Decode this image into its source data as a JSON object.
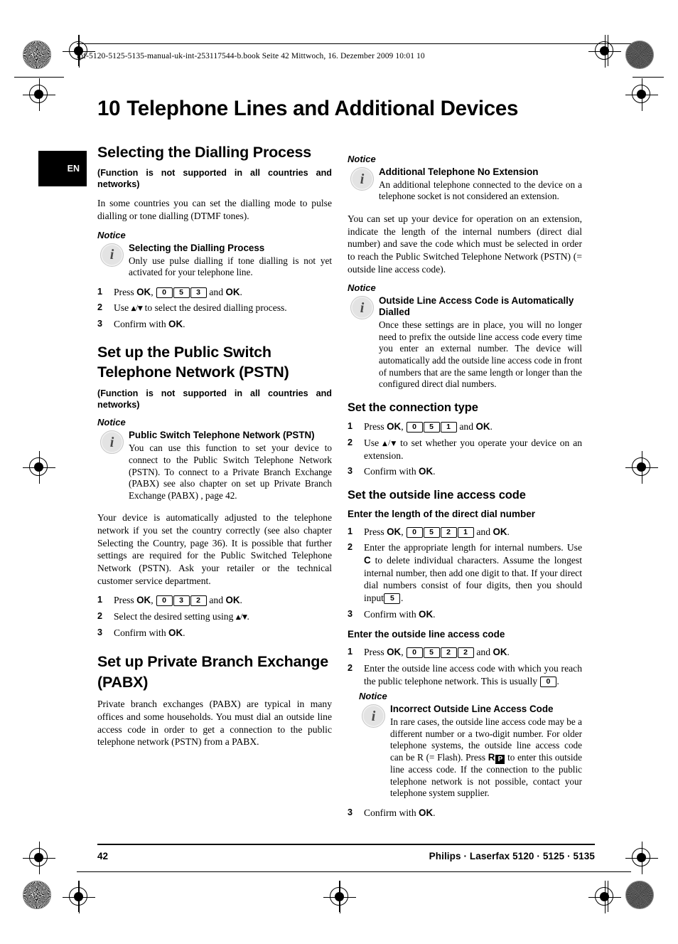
{
  "slug": "lpf-5120-5125-5135-manual-uk-int-253117544-b.book  Seite 42  Mittwoch, 16. Dezember 2009  10:01 10",
  "chapter": {
    "number": "10",
    "title": "Telephone Lines and Additional Devices"
  },
  "language_tab": "EN",
  "left_column": {
    "section1": {
      "heading": "Selecting the Dialling Process",
      "bold_note": "(Function is not supported in all countries and networks)",
      "intro": "In some countries you can set the dialling mode to pulse dialling or tone dialling (DTMF tones).",
      "notice_label": "Notice",
      "notice_title": "Selecting the Dialling Process",
      "notice_text": "Only use pulse dialling if tone dialling is not yet activated for your telephone line.",
      "steps": [
        {
          "n": "1",
          "text_pre": "Press ",
          "ok1": "OK",
          "comma": ", ",
          "keys": [
            "0",
            "5",
            "3"
          ],
          "text_mid": " and ",
          "ok2": "OK",
          "text_post": "."
        },
        {
          "n": "2",
          "text_pre": "Use ",
          "arrows": true,
          "text_post": " to select the desired dialling process."
        },
        {
          "n": "3",
          "text_pre": "Confirm with ",
          "ok1": "OK",
          "text_post": "."
        }
      ]
    },
    "section2": {
      "heading": "Set up the Public Switch Telephone Network (PSTN)",
      "bold_note": "(Function is not supported in all countries and networks)",
      "notice_label": "Notice",
      "notice_title": "Public Switch Telephone Network (PSTN)",
      "notice_text": "You can use this function to set your device to connect to the Public Switch Telephone Network (PSTN). To connect to a Private Branch Exchange (PABX) see also chapter on  set up Private Branch Exchange (PABX) , page  42.",
      "body": "Your device is automatically adjusted to the telephone network if you set the country correctly (see also chapter Selecting the Country, page 36). It is possible that further settings are required for the Public Switched Telephone Network (PSTN). Ask your retailer or the technical customer service department.",
      "steps": [
        {
          "n": "1",
          "text_pre": "Press ",
          "ok1": "OK",
          "comma": ", ",
          "keys": [
            "0",
            "3",
            "2"
          ],
          "text_mid": " and ",
          "ok2": "OK",
          "text_post": "."
        },
        {
          "n": "2",
          "text_pre": "Select the desired setting using ",
          "arrows": true,
          "text_post": "."
        },
        {
          "n": "3",
          "text_pre": "Confirm with ",
          "ok1": "OK",
          "text_post": "."
        }
      ]
    },
    "section3": {
      "heading": "Set up Private Branch Exchange (PABX)",
      "body": "Private branch exchanges (PABX) are typical in many offices and some households. You must dial an outside line access code in order to get a connection to the public telephone network (PSTN) from a PABX."
    }
  },
  "right_column": {
    "notice1": {
      "label": "Notice",
      "title": "Additional Telephone No Extension",
      "text": "An additional telephone connected to the device on a telephone socket is not considered an extension."
    },
    "body1": "You can set up your device for operation on an extension, indicate the length of the internal numbers (direct dial number) and save the code which must be selected in order to reach the Public Switched Telephone Network (PSTN) (= outside line access code).",
    "notice2": {
      "label": "Notice",
      "title": "Outside Line Access Code is Automatically Dialled",
      "text": "Once these settings are in place, you will no longer need to prefix the outside line access code every time you enter an external number. The device will automatically add the outside line access code in front of numbers that are the same length or longer than the configured direct dial numbers."
    },
    "section_connection": {
      "heading": "Set the connection type",
      "steps": [
        {
          "n": "1",
          "text_pre": "Press ",
          "ok1": "OK",
          "comma": ", ",
          "keys": [
            "0",
            "5",
            "1"
          ],
          "text_mid": " and ",
          "ok2": "OK",
          "text_post": "."
        },
        {
          "n": "2",
          "text_pre": "Use ",
          "arrows": true,
          "text_post": " to set whether you operate your device on an extension."
        },
        {
          "n": "3",
          "text_pre": "Confirm with ",
          "ok1": "OK",
          "text_post": "."
        }
      ]
    },
    "section_access": {
      "heading": "Set the outside line access code",
      "sub1": {
        "heading": "Enter the length of the direct dial number",
        "step1": {
          "n": "1",
          "text_pre": "Press ",
          "ok1": "OK",
          "comma": ", ",
          "keys": [
            "0",
            "5",
            "2",
            "1"
          ],
          "text_mid": " and ",
          "ok2": "OK",
          "text_post": "."
        },
        "step2_n": "2",
        "step2_a": "Enter the appropriate length for internal numbers. Use ",
        "step2_ckey": "C",
        "step2_b": " to delete individual characters. Assume the longest internal number, then add one digit to that. If your direct dial numbers consist of four digits, then you should input",
        "step2_key": "5",
        "step2_c": ".",
        "step3": {
          "n": "3",
          "text_pre": "Confirm with ",
          "ok1": "OK",
          "text_post": "."
        }
      },
      "sub2": {
        "heading": "Enter the outside line access code",
        "step1": {
          "n": "1",
          "text_pre": "Press ",
          "ok1": "OK",
          "comma": ", ",
          "keys": [
            "0",
            "5",
            "2",
            "2"
          ],
          "text_mid": " and ",
          "ok2": "OK",
          "text_post": "."
        },
        "step2_n": "2",
        "step2_a": "Enter the outside line access code with which you reach the public telephone network. This is usually ",
        "step2_key": "0",
        "step2_b": ".",
        "notice": {
          "label": "Notice",
          "title": "Incorrect Outside Line Access Code",
          "text_a": "In rare cases, the outside line access code may be a different number or a two-digit number. For older telephone systems, the outside line access code can be R (= Flash). Press ",
          "flash_r": "R",
          "flash_p": "P",
          "text_b": " to enter this outside line access code. If the connection to the public telephone network is not possible, contact your telephone system supplier."
        },
        "step3": {
          "n": "3",
          "text_pre": "Confirm with ",
          "ok1": "OK",
          "text_post": "."
        }
      }
    }
  },
  "footer": {
    "page_number": "42",
    "brand": "Philips · Laserfax 5120 · 5125 · 5135"
  }
}
